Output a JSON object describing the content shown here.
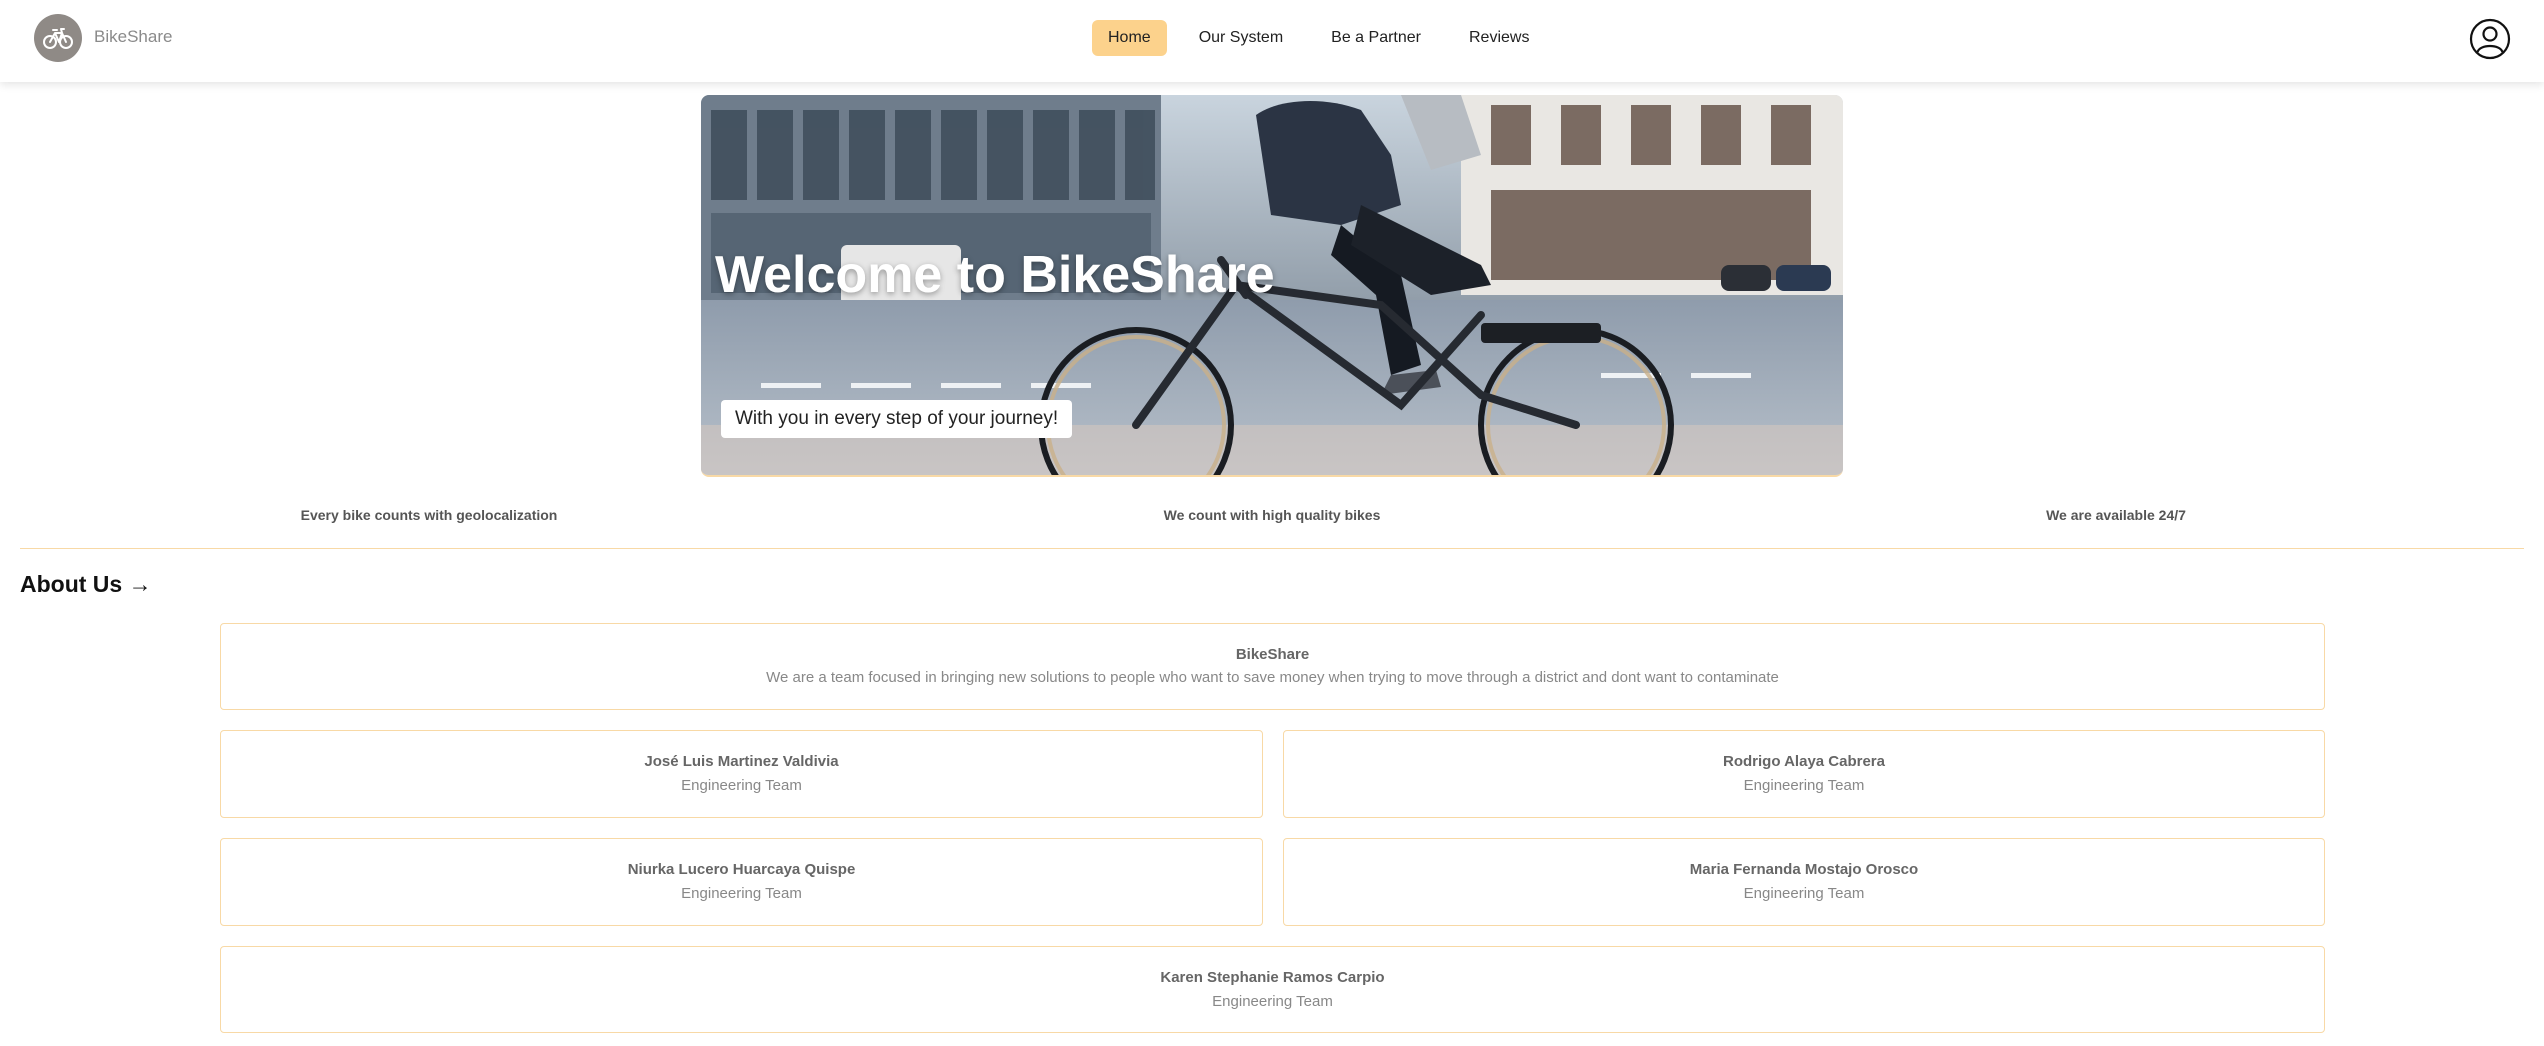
{
  "header": {
    "brand": "BikeShare",
    "logo_icon": "bicycle-icon",
    "user_icon": "user-circle-icon",
    "nav": [
      {
        "label": "Home",
        "active": true
      },
      {
        "label": "Our System",
        "active": false
      },
      {
        "label": "Be a Partner",
        "active": false
      },
      {
        "label": "Reviews",
        "active": false
      }
    ]
  },
  "hero": {
    "title": "Welcome to BikeShare",
    "subtitle": "With you in every step of your journey!"
  },
  "features": [
    "Every bike counts with geolocalization",
    "We count with high quality bikes",
    "We are available 24/7"
  ],
  "about": {
    "title": "About Us →",
    "intro": {
      "name": "BikeShare",
      "description": "We are a team focused in bringing new solutions to people who want to save money when trying to move through a district and dont want to contaminate"
    },
    "members": [
      {
        "name": "José Luis Martinez Valdivia",
        "role": "Engineering Team"
      },
      {
        "name": "Rodrigo Alaya Cabrera",
        "role": "Engineering Team"
      },
      {
        "name": "Niurka Lucero Huarcaya Quispe",
        "role": "Engineering Team"
      },
      {
        "name": "Maria Fernanda Mostajo Orosco",
        "role": "Engineering Team"
      },
      {
        "name": "Karen Stephanie Ramos Carpio",
        "role": "Engineering Team"
      }
    ]
  },
  "colors": {
    "accent": "#fcd28c",
    "card_border": "#f8d9a6",
    "logo_bg": "#8f8a86"
  }
}
